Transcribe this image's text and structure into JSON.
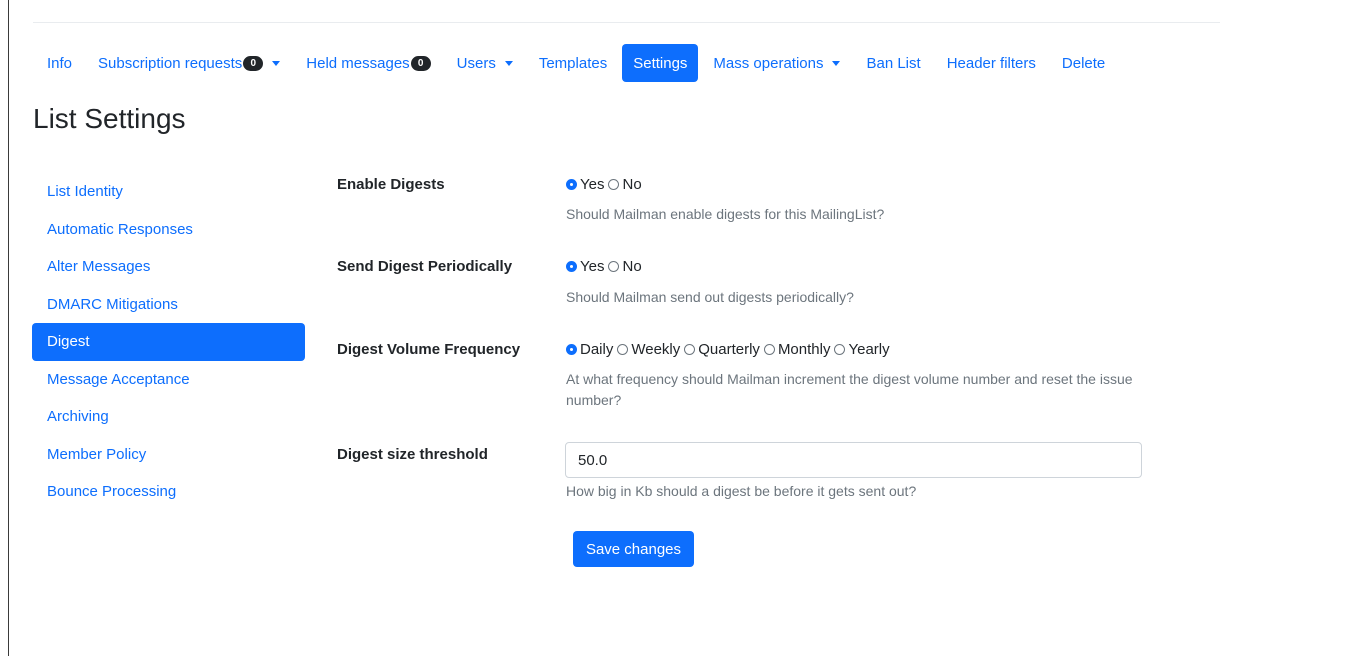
{
  "topnav": {
    "items": [
      {
        "label": "Info"
      },
      {
        "label": "Subscription requests",
        "badge": "0"
      },
      {
        "label": "Held messages",
        "badge": "0"
      },
      {
        "label": "Users"
      },
      {
        "label": "Templates"
      },
      {
        "label": "Settings"
      },
      {
        "label": "Mass operations"
      },
      {
        "label": "Ban List"
      },
      {
        "label": "Header filters"
      },
      {
        "label": "Delete"
      }
    ],
    "active": "Settings"
  },
  "page_title": "List Settings",
  "sidenav": {
    "items": [
      {
        "label": "List Identity"
      },
      {
        "label": "Automatic Responses"
      },
      {
        "label": "Alter Messages"
      },
      {
        "label": "DMARC Mitigations"
      },
      {
        "label": "Digest"
      },
      {
        "label": "Message Acceptance"
      },
      {
        "label": "Archiving"
      },
      {
        "label": "Member Policy"
      },
      {
        "label": "Bounce Processing"
      }
    ],
    "active": "Digest"
  },
  "form": {
    "enable_digests": {
      "label": "Enable Digests",
      "options": [
        "Yes",
        "No"
      ],
      "selected": "Yes",
      "help": "Should Mailman enable digests for this MailingList?"
    },
    "send_digest_periodically": {
      "label": "Send Digest Periodically",
      "options": [
        "Yes",
        "No"
      ],
      "selected": "Yes",
      "help": "Should Mailman send out digests periodically?"
    },
    "digest_volume_frequency": {
      "label": "Digest Volume Frequency",
      "options": [
        "Daily",
        "Weekly",
        "Quarterly",
        "Monthly",
        "Yearly"
      ],
      "selected": "Daily",
      "help": "At what frequency should Mailman increment the digest volume number and reset the issue number?"
    },
    "digest_size_threshold": {
      "label": "Digest size threshold",
      "value": "50.0",
      "help": "How big in Kb should a digest be before it gets sent out?"
    },
    "save_label": "Save changes"
  },
  "colors": {
    "primary": "#0d6efd",
    "text": "#212529",
    "muted": "#6c757d",
    "badge": "#212529"
  }
}
